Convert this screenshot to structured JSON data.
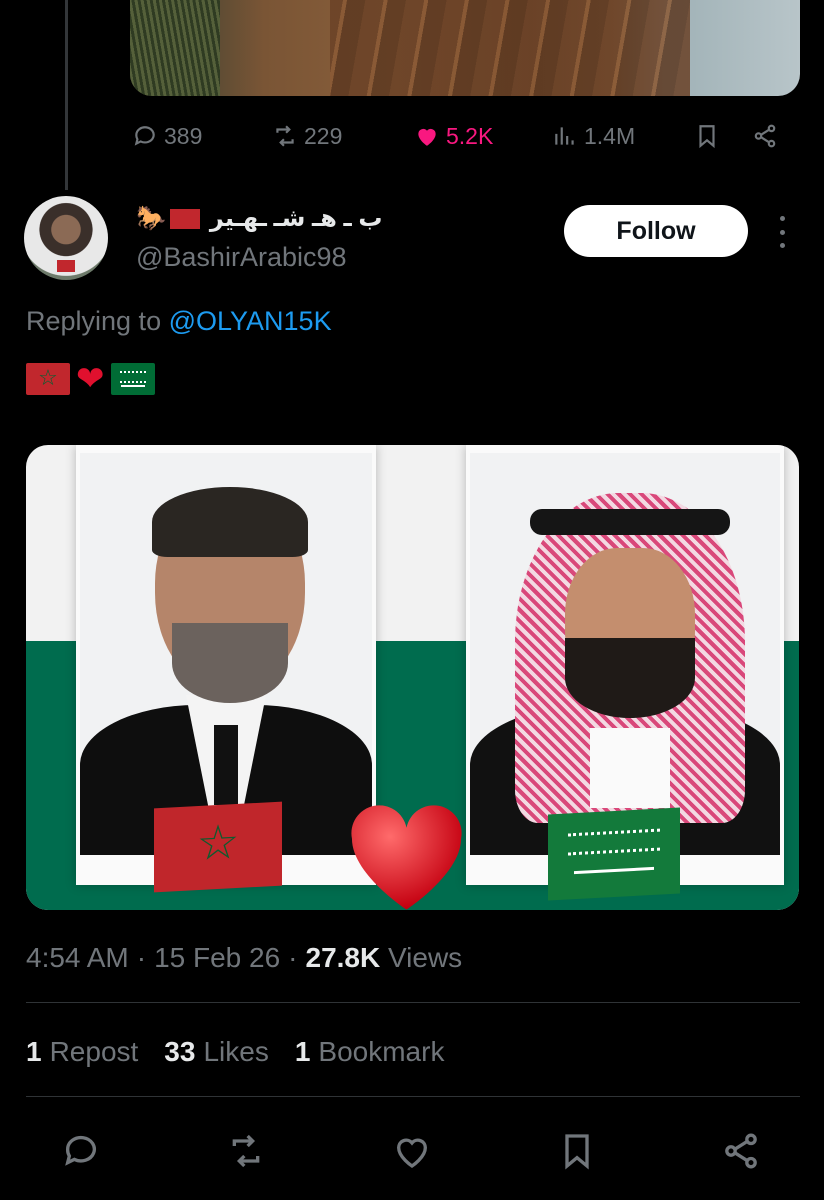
{
  "parent_tweet": {
    "replies": "389",
    "reposts": "229",
    "likes": "5.2K",
    "views": "1.4M"
  },
  "author": {
    "display_name": "ب ـ هـ شـ ـهـير",
    "handle": "@BashirArabic98",
    "follow_label": "Follow"
  },
  "reply": {
    "prefix": "Replying to",
    "mention": "@OLYAN15K"
  },
  "timestamp": {
    "time": "4:54 AM",
    "date": "15 Feb 26",
    "views_count": "27.8K",
    "views_label": "Views"
  },
  "stats": {
    "reposts_count": "1",
    "reposts_label": "Repost",
    "likes_count": "33",
    "likes_label": "Likes",
    "bookmarks_count": "1",
    "bookmarks_label": "Bookmark"
  },
  "icons": [
    "reply-icon",
    "repost-icon",
    "like-icon",
    "views-icon",
    "bookmark-icon",
    "share-icon",
    "more-icon"
  ],
  "colors": {
    "background": "#000000",
    "text": "#e7e9ea",
    "muted": "#71767b",
    "link": "#1d9bf0",
    "like": "#f91880"
  }
}
